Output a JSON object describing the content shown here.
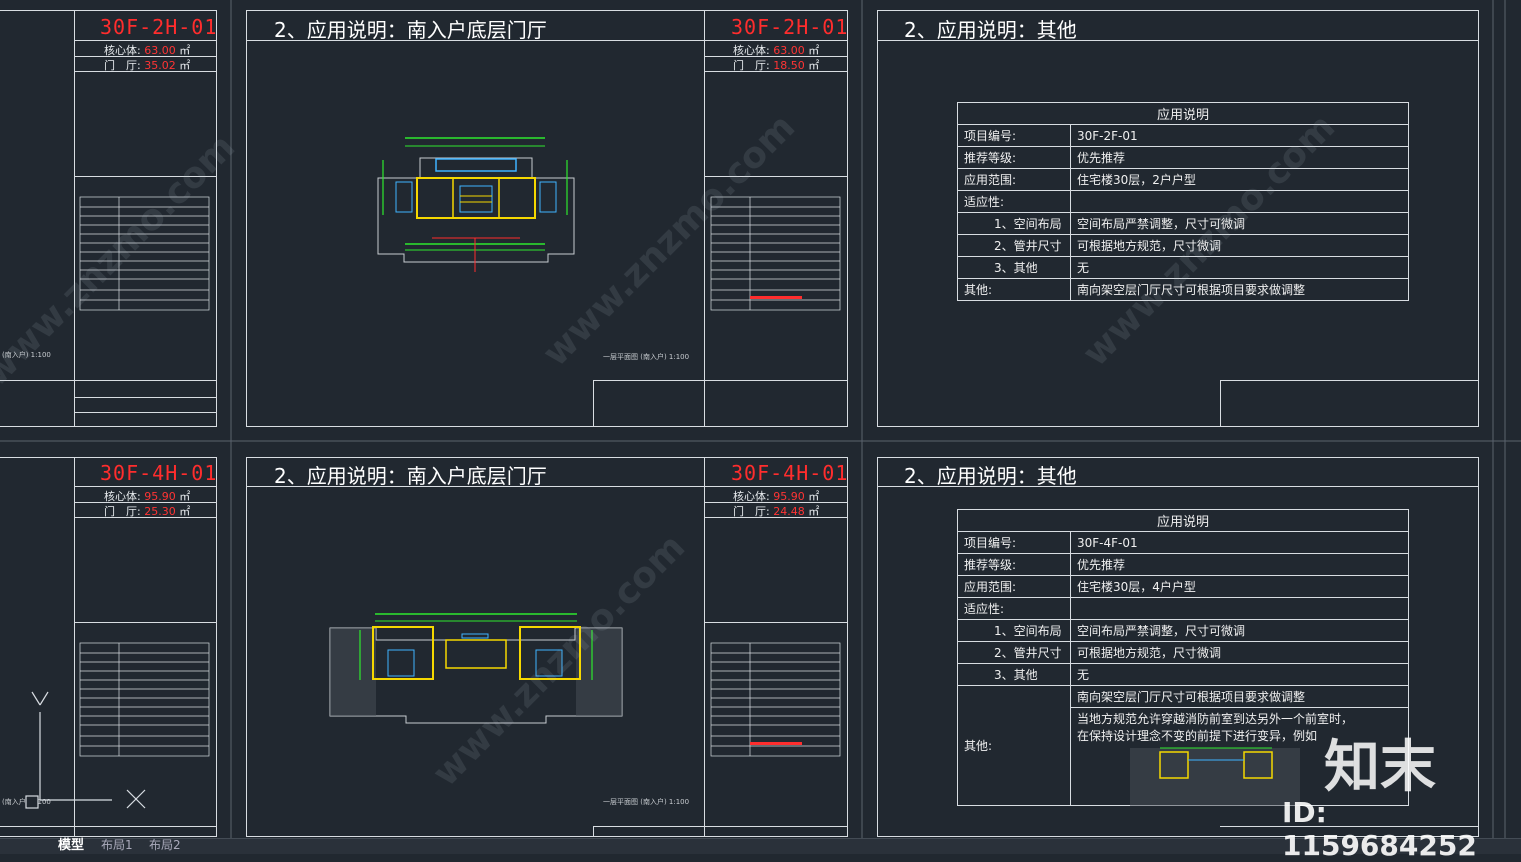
{
  "sheets": {
    "s1": {
      "code": "30F-2H-01",
      "core_label": "核心体:",
      "core_value": "63.00",
      "hall_label": "门　厅:",
      "hall_value": "35.02",
      "unit": "㎡"
    },
    "s2": {
      "title": "2、应用说明：南入户底层门厅",
      "code": "30F-2H-01",
      "core_label": "核心体:",
      "core_value": "63.00",
      "hall_label": "门　厅:",
      "hall_value": "18.50",
      "unit": "㎡"
    },
    "s3": {
      "title": "2、应用说明：其他"
    },
    "s4": {
      "code": "30F-4H-01",
      "core_label": "核心体:",
      "core_value": "95.90",
      "hall_label": "门　厅:",
      "hall_value": "25.30",
      "unit": "㎡"
    },
    "s5": {
      "title": "2、应用说明：南入户底层门厅",
      "code": "30F-4H-01",
      "core_label": "核心体:",
      "core_value": "95.90",
      "hall_label": "门　厅:",
      "hall_value": "24.48",
      "unit": "㎡"
    },
    "s6": {
      "title": "2、应用说明：其他"
    }
  },
  "table1": {
    "header": "应用说明",
    "rows": [
      {
        "k": "项目编号:",
        "v": "30F-2F-01"
      },
      {
        "k": "推荐等级:",
        "v": "优先推荐"
      },
      {
        "k": "应用范围:",
        "v": "住宅楼30层，2户户型"
      },
      {
        "k": "适应性:",
        "v": ""
      },
      {
        "k": "1、空间布局",
        "v": "空间布局严禁调整，尺寸可微调"
      },
      {
        "k": "2、管井尺寸",
        "v": "可根据地方规范，尺寸微调"
      },
      {
        "k": "3、其他",
        "v": "无"
      },
      {
        "k": "其他:",
        "v": "南向架空层门厅尺寸可根据项目要求做调整"
      }
    ]
  },
  "table2": {
    "header": "应用说明",
    "rows": [
      {
        "k": "项目编号:",
        "v": "30F-4F-01"
      },
      {
        "k": "推荐等级:",
        "v": "优先推荐"
      },
      {
        "k": "应用范围:",
        "v": "住宅楼30层，4户户型"
      },
      {
        "k": "适应性:",
        "v": ""
      },
      {
        "k": "1、空间布局",
        "v": "空间布局严禁调整，尺寸可微调"
      },
      {
        "k": "2、管井尺寸",
        "v": "可根据地方规范，尺寸微调"
      },
      {
        "k": "3、其他",
        "v": "无"
      }
    ],
    "other_label": "其他:",
    "other_lines": [
      "南向架空层门厅尺寸可根据项目要求做调整",
      "当地方规范允许穿越消防前室到达另外一个前室时，",
      "在保持设计理念不变的前提下进行变异，例如"
    ]
  },
  "plan_captions": {
    "left": "(南入户) 1:100",
    "plan_2h": "一层平面图 (南入户) 1:100",
    "plan_4h": "一层平面图 (南入户) 1:100"
  },
  "tabs": {
    "model": "模型",
    "layout1": "布局1",
    "layout2": "布局2"
  },
  "watermark": {
    "brand": "知末",
    "id": "ID: 1159684252",
    "site": "www.znzmo.com"
  },
  "ucs": {
    "y": "Y"
  },
  "colors": {
    "background": "#212830",
    "frame": "#d8dde2",
    "code": "#ff2d2d",
    "plan_yellow": "#f5d800",
    "plan_green": "#2ee82e",
    "plan_cyan": "#3fb3ff"
  }
}
